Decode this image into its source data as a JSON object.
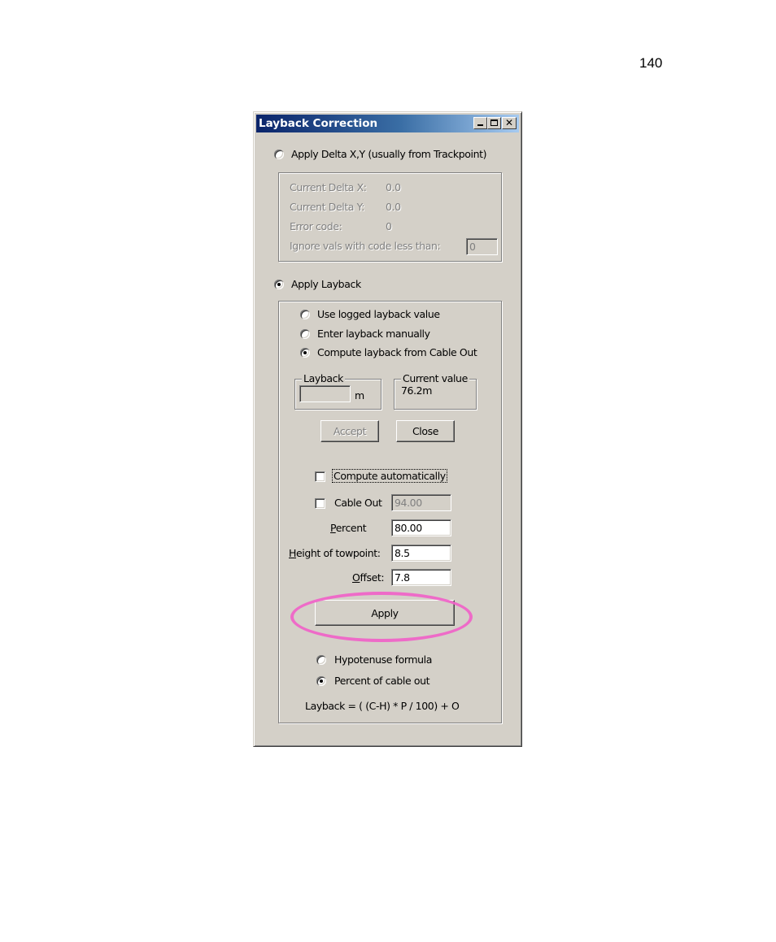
{
  "page": {
    "number": "140"
  },
  "window": {
    "title": "Layback Correction",
    "controls": {
      "minimize": "_",
      "maximize": "□",
      "close": "✕"
    }
  },
  "delta_section": {
    "radio_label": "Apply Delta X,Y (usually from Trackpoint)",
    "selected": false,
    "rows": [
      {
        "label": "Current Delta X:",
        "value": "0.0"
      },
      {
        "label": "Current Delta Y:",
        "value": "0.0"
      },
      {
        "label": "Error code:",
        "value": "0"
      }
    ],
    "ignore_label": "Ignore vals with code less than:",
    "ignore_value": "0"
  },
  "layback_section": {
    "radio_label": "Apply Layback",
    "selected": true,
    "options": [
      {
        "label": "Use logged layback value",
        "selected": false
      },
      {
        "label": "Enter layback manually",
        "selected": false
      },
      {
        "label": "Compute layback from Cable Out",
        "selected": true
      }
    ],
    "layback_group": {
      "legend": "Layback",
      "value": "",
      "unit": "m"
    },
    "current_group": {
      "legend": "Current value",
      "value": "76.2m"
    },
    "accept_label": "Accept",
    "close_label": "Close",
    "compute_auto": {
      "label": "Compute automatically",
      "checked": false
    },
    "cable_out": {
      "label": "Cable Out",
      "checked": false,
      "value": "94.00"
    },
    "percent": {
      "label_first": "P",
      "label_rest": "ercent",
      "value": "80.00"
    },
    "height": {
      "label_first": "H",
      "label_rest": "eight of towpoint:",
      "value": "8.5"
    },
    "offset": {
      "label_first": "O",
      "label_rest": "ffset:",
      "value": "7.8"
    },
    "apply_label": "Apply",
    "formula_options": [
      {
        "label": "Hypotenuse formula",
        "selected": false
      },
      {
        "label": "Percent of cable out",
        "selected": true
      }
    ],
    "formula_text": "Layback = ( (C-H) * P / 100) + O"
  },
  "annotation": {
    "highlight_color": "#f062c8",
    "highlights": "apply-button"
  }
}
